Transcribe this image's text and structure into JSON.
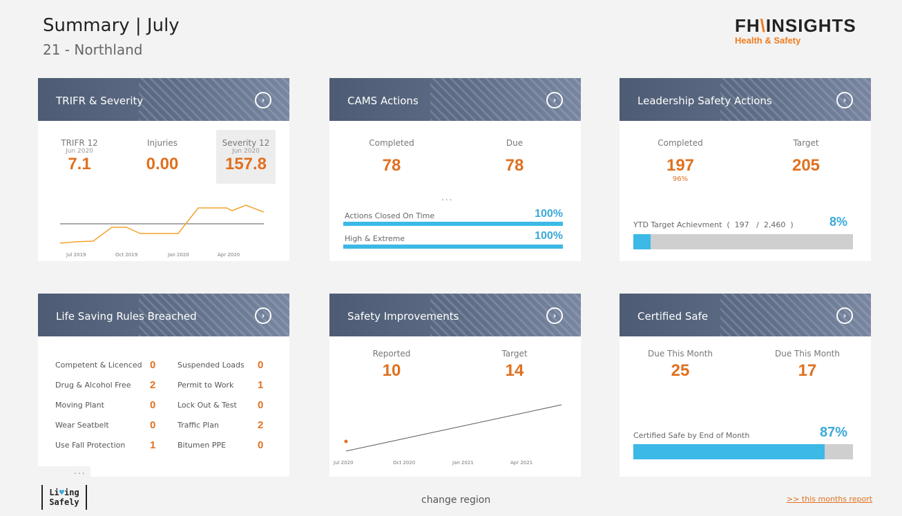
{
  "header": {
    "title": "Summary | July",
    "subtitle": "21 - Northland",
    "brand_left": "FH",
    "brand_slash": "\\",
    "brand_right": "INSIGHTS",
    "brand_sub": "Health & Safety"
  },
  "go_glyph": "›",
  "trifr": {
    "title": "TRIFR & Severity",
    "trifr_label": "TRIFR 12",
    "trifr_date": "Jun 2020",
    "trifr_value": "7.1",
    "injuries_label": "Injuries",
    "injuries_value": "0.00",
    "severity_label": "Severity 12",
    "severity_date": "Jun 2020",
    "severity_value": "157.8",
    "axis": [
      "Jul 2019",
      "Oct 2019",
      "Jan 2020",
      "Apr 2020"
    ]
  },
  "cams": {
    "title": "CAMS Actions",
    "completed_label": "Completed",
    "completed_value": "78",
    "due_label": "Due",
    "due_value": "78",
    "dots": "...",
    "closed_label": "Actions Closed On Time",
    "closed_pct": "100%",
    "high_label": "High & Extreme",
    "high_pct": "100%"
  },
  "leadership": {
    "title": "Leadership Safety Actions",
    "completed_label": "Completed",
    "completed_value": "197",
    "completed_pct": "96%",
    "target_label": "Target",
    "target_value": "205",
    "ytd_label": "YTD Target Achievment  (  197   /  2,460  )",
    "ytd_pct": "8%",
    "ytd_fill": 0.08
  },
  "lsr": {
    "title": "Life Saving Rules Breached",
    "left": [
      {
        "label": "Competent & Licenced",
        "value": "0"
      },
      {
        "label": "Drug & Alcohol Free",
        "value": "2"
      },
      {
        "label": "Moving Plant",
        "value": "0"
      },
      {
        "label": "Wear Seatbelt",
        "value": "0"
      },
      {
        "label": "Use Fall Protection",
        "value": "1"
      }
    ],
    "right": [
      {
        "label": "Suspended Loads",
        "value": "0"
      },
      {
        "label": "Permit to Work",
        "value": "1"
      },
      {
        "label": "Lock Out & Test",
        "value": "0"
      },
      {
        "label": "Traffic Plan",
        "value": "2"
      },
      {
        "label": "Bitumen PPE",
        "value": "0"
      }
    ],
    "dots": "..."
  },
  "improvements": {
    "title": "Safety Improvements",
    "reported_label": "Reported",
    "reported_value": "10",
    "target_label": "Target",
    "target_value": "14",
    "axis": [
      "Jul 2020",
      "Oct 2020",
      "Jan 2021",
      "Apr 2021"
    ]
  },
  "certified": {
    "title": "Certified Safe",
    "due1_label": "Due This Month",
    "due1_value": "25",
    "due2_label": "Due This Month",
    "due2_value": "17",
    "bar_label": "Certified Safe by End of Month",
    "bar_pct": "87%",
    "bar_fill": 0.87
  },
  "footer": {
    "logo_line1a": "Li",
    "logo_heart": "♥",
    "logo_line1b": "ing",
    "logo_line2": "Safely",
    "change_region": "change region",
    "report_link": ">> this months report"
  },
  "colors": {
    "accent_orange": "#e0701f",
    "accent_blue": "#3cb9e6",
    "header_slate": "#5e6d85",
    "bar_grey": "#cfcfcf"
  }
}
